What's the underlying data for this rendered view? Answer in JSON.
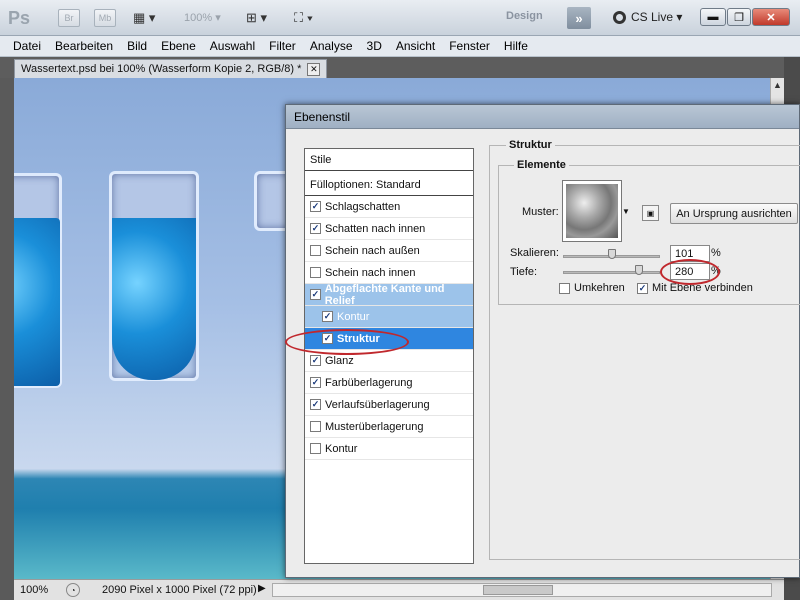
{
  "appbar": {
    "logo": "Ps",
    "bridge_label": "Br",
    "minibridge_label": "Mb",
    "zoom_value": "100%",
    "workspace_label": "Design",
    "cs_live_label": "CS Live",
    "forward_icon": "»"
  },
  "menu": [
    "Datei",
    "Bearbeiten",
    "Bild",
    "Ebene",
    "Auswahl",
    "Filter",
    "Analyse",
    "3D",
    "Ansicht",
    "Fenster",
    "Hilfe"
  ],
  "document": {
    "tab_title": "Wassertext.psd bei 100% (Wasserform Kopie 2, RGB/8) *",
    "zoom": "100%",
    "info": "2090 Pixel x 1000 Pixel (72 ppi)"
  },
  "dialog": {
    "title": "Ebenenstil",
    "styles": {
      "header": "Stile",
      "blend_options": "Fülloptionen: Standard",
      "items": [
        {
          "label": "Schlagschatten",
          "checked": true
        },
        {
          "label": "Schatten nach innen",
          "checked": true
        },
        {
          "label": "Schein nach außen",
          "checked": false
        },
        {
          "label": "Schein nach innen",
          "checked": false
        },
        {
          "label": "Abgeflachte Kante und Relief",
          "checked": true
        },
        {
          "label": "Kontur",
          "checked": true
        },
        {
          "label": "Struktur",
          "checked": true
        },
        {
          "label": "Glanz",
          "checked": true
        },
        {
          "label": "Farbüberlagerung",
          "checked": true
        },
        {
          "label": "Verlaufsüberlagerung",
          "checked": true
        },
        {
          "label": "Musterüberlagerung",
          "checked": false
        },
        {
          "label": "Kontur",
          "checked": false
        }
      ]
    },
    "structure": {
      "section_title": "Struktur",
      "group_title": "Elemente",
      "pattern_label": "Muster:",
      "origin_button": "An Ursprung ausrichten",
      "scale_label": "Skalieren:",
      "scale_value": "101",
      "scale_unit": "%",
      "scale_level": 0.5,
      "depth_label": "Tiefe:",
      "depth_value": "280",
      "depth_unit": "%",
      "depth_level": 0.78,
      "invert_label": "Umkehren",
      "invert_checked": false,
      "link_label": "Mit Ebene verbinden",
      "link_checked": true
    }
  }
}
